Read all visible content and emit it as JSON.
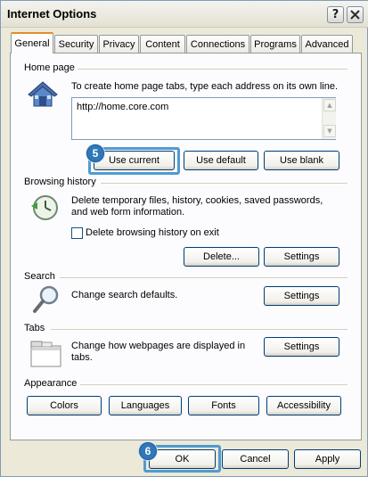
{
  "window": {
    "title": "Internet Options",
    "help_label": "?",
    "close_label": "✕"
  },
  "tabs": [
    {
      "label": "General",
      "active": true
    },
    {
      "label": "Security"
    },
    {
      "label": "Privacy"
    },
    {
      "label": "Content"
    },
    {
      "label": "Connections"
    },
    {
      "label": "Programs"
    },
    {
      "label": "Advanced"
    }
  ],
  "home_page": {
    "label": "Home page",
    "description": "To create home page tabs, type each address on its own line.",
    "url": "http://home.core.com",
    "buttons": {
      "use_current": "Use current",
      "use_default": "Use default",
      "use_blank": "Use blank"
    },
    "step": "5"
  },
  "browsing_history": {
    "label": "Browsing history",
    "description": "Delete temporary files, history, cookies, saved passwords, and web form information.",
    "checkbox_label": "Delete browsing history on exit",
    "checkbox_checked": false,
    "buttons": {
      "delete": "Delete...",
      "settings": "Settings"
    }
  },
  "search": {
    "label": "Search",
    "description": "Change search defaults.",
    "settings": "Settings"
  },
  "tabs_section": {
    "label": "Tabs",
    "description": "Change how webpages are displayed in tabs.",
    "settings": "Settings"
  },
  "appearance": {
    "label": "Appearance",
    "buttons": {
      "colors": "Colors",
      "languages": "Languages",
      "fonts": "Fonts",
      "accessibility": "Accessibility"
    }
  },
  "footer": {
    "ok": "OK",
    "cancel": "Cancel",
    "apply": "Apply",
    "step": "6"
  },
  "colors": {
    "highlight": "#4f9bd0",
    "step_badge": "#2f78b9",
    "active_tab": "#e68b2c"
  }
}
